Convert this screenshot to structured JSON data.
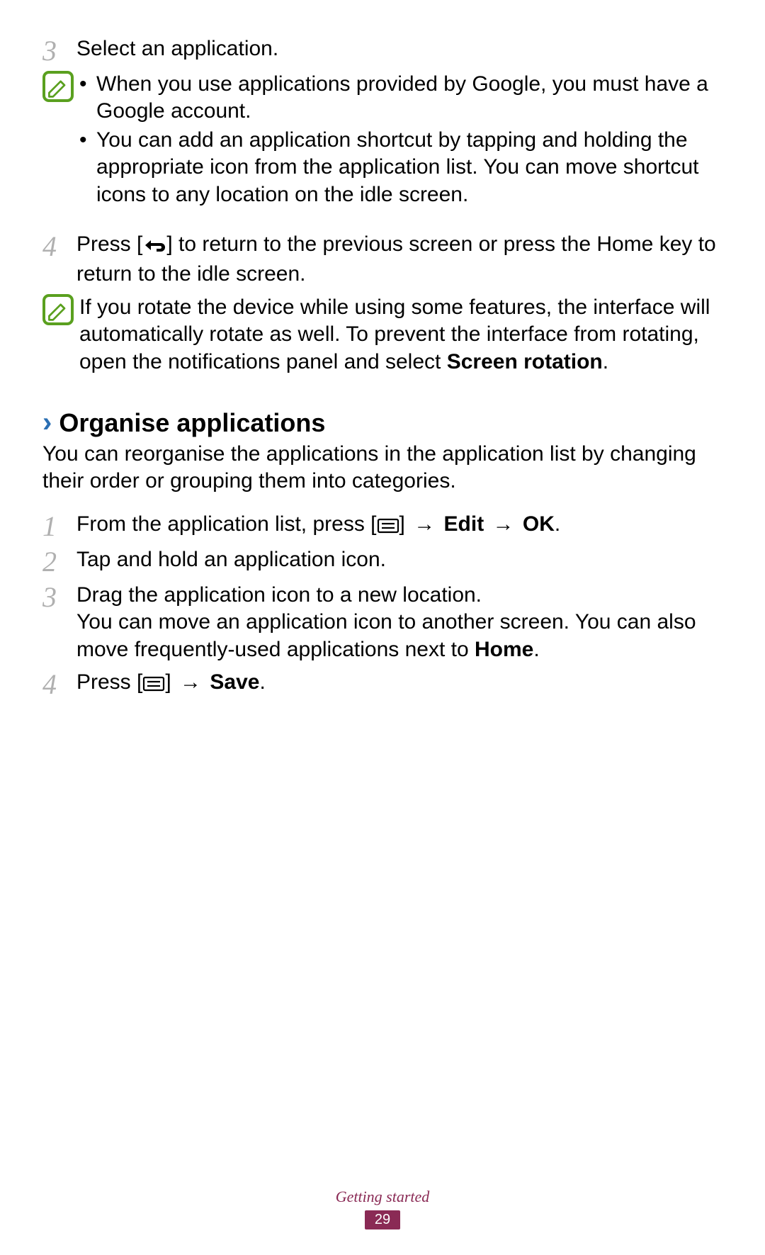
{
  "step3": {
    "num": "3",
    "text": "Select an application."
  },
  "note1": {
    "bullets": [
      "When you use applications provided by Google, you must have a Google account.",
      "You can add an application shortcut by tapping and holding the appropriate icon from the application list. You can move shortcut icons to any location on the idle screen."
    ]
  },
  "step4": {
    "num": "4",
    "pre": "Press [",
    "post": "] to return to the previous screen or press the Home key to return to the idle screen."
  },
  "note2": {
    "pre": "If you rotate the device while using some features, the interface will automatically rotate as well. To prevent the interface from rotating, open the notifications panel and select ",
    "bold": "Screen rotation",
    "post": "."
  },
  "section": {
    "title": "Organise applications",
    "intro": "You can reorganise the applications in the application list by changing their order or grouping them into categories."
  },
  "org": {
    "s1": {
      "num": "1",
      "pre": "From the application list, press [",
      "mid": "] ",
      "arrow": "→",
      "b1": "Edit",
      "b2": "OK",
      "post": "."
    },
    "s2": {
      "num": "2",
      "text": "Tap and hold an application icon."
    },
    "s3": {
      "num": "3",
      "line1": "Drag the application icon to a new location.",
      "line2a": "You can move an application icon to another screen. You can also move frequently-used applications next to ",
      "line2bold": "Home",
      "line2b": "."
    },
    "s4": {
      "num": "4",
      "pre": "Press [",
      "mid": "] ",
      "arrow": "→",
      "b1": "Save",
      "post": "."
    }
  },
  "footer": {
    "section": "Getting started",
    "page": "29"
  }
}
